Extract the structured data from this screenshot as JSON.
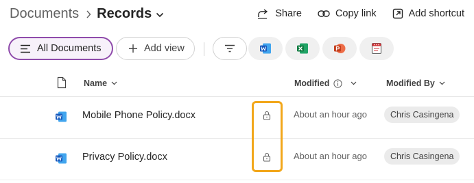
{
  "header": {
    "breadcrumb_root": "Documents",
    "breadcrumb_current": "Records",
    "actions": {
      "share": "Share",
      "copy_link": "Copy link",
      "add_shortcut": "Add shortcut"
    }
  },
  "viewbar": {
    "all_documents": "All Documents",
    "add_view": "Add view",
    "app_filters": [
      "word-icon",
      "excel-icon",
      "powerpoint-icon",
      "forms-icon"
    ]
  },
  "table": {
    "columns": {
      "name": "Name",
      "modified": "Modified",
      "modified_by": "Modified By"
    },
    "rows": [
      {
        "name": "Mobile Phone Policy.docx",
        "modified": "About an hour ago",
        "modified_by": "Chris Casingena",
        "locked": true
      },
      {
        "name": "Privacy Policy.docx",
        "modified": "About an hour ago",
        "modified_by": "Chris Casingena",
        "locked": true
      }
    ]
  },
  "colors": {
    "accent": "#8f4bab",
    "highlight": "#f2a71b",
    "word": "#185abd",
    "excel": "#107c41",
    "powerpoint": "#c43e1c",
    "forms": "#d13438"
  }
}
